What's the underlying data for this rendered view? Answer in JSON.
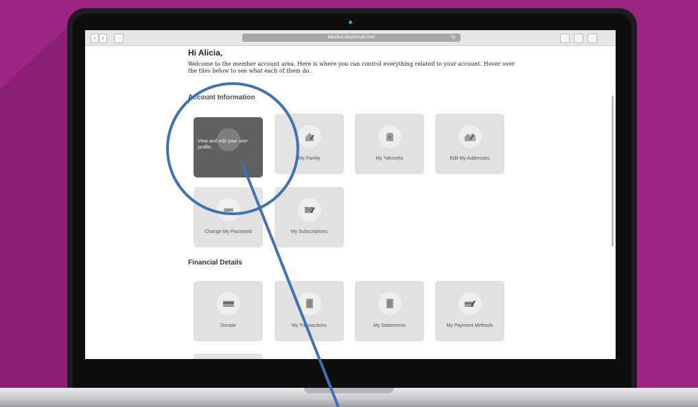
{
  "browser": {
    "url": "labshul.shulcloud.com",
    "back_label": "‹",
    "forward_label": "›"
  },
  "page": {
    "greeting": "Hi Alicia,",
    "welcome_text": "Welcome to the member account area. Here is where you can control everything related to your account. Hover over the tiles below to see what each of them do."
  },
  "account_section": {
    "title": "Account Information",
    "hover_text": "View and edit your user profile.",
    "tiles": [
      {
        "label": "My Family",
        "icon": "family-icon"
      },
      {
        "label": "My Yahrzeits",
        "icon": "yahrzeit-icon"
      },
      {
        "label": "Edit My Addresses",
        "icon": "addresses-icon"
      },
      {
        "label": "Change My Password",
        "icon": "password-icon"
      },
      {
        "label": "My Subscriptions",
        "icon": "subscriptions-icon"
      }
    ]
  },
  "financial_section": {
    "title": "Financial Details",
    "tiles": [
      {
        "label": "Donate",
        "icon": "donate-icon"
      },
      {
        "label": "My Transactions",
        "icon": "transactions-icon"
      },
      {
        "label": "My Statements",
        "icon": "statements-icon"
      },
      {
        "label": "My Payment Methods",
        "icon": "payment-methods-icon"
      }
    ]
  },
  "colors": {
    "background": "#9b2583",
    "annotation": "#3f72b3",
    "tile": "#e1e1e1",
    "tile_hover": "#4a4a4a"
  }
}
